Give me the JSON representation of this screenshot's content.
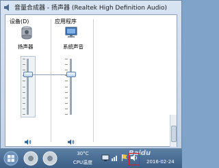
{
  "window": {
    "title": "音量合成器 - 扬声器 (Realtek High Definition Audio)"
  },
  "device_group": {
    "label": "设备(D)",
    "device_name": "扬声器",
    "volume_level": 0.72
  },
  "apps_group": {
    "label": "应用程序",
    "app_name": "系统声音",
    "volume_level": 0.72
  },
  "taskbar": {
    "cpu_temp": "30°C",
    "cpu_label": "CPU温度",
    "date": "2016-02-24",
    "watermark": "Baidu"
  },
  "colors": {
    "accent": "#3d5f86",
    "highlight_box": "#e01a1a"
  }
}
